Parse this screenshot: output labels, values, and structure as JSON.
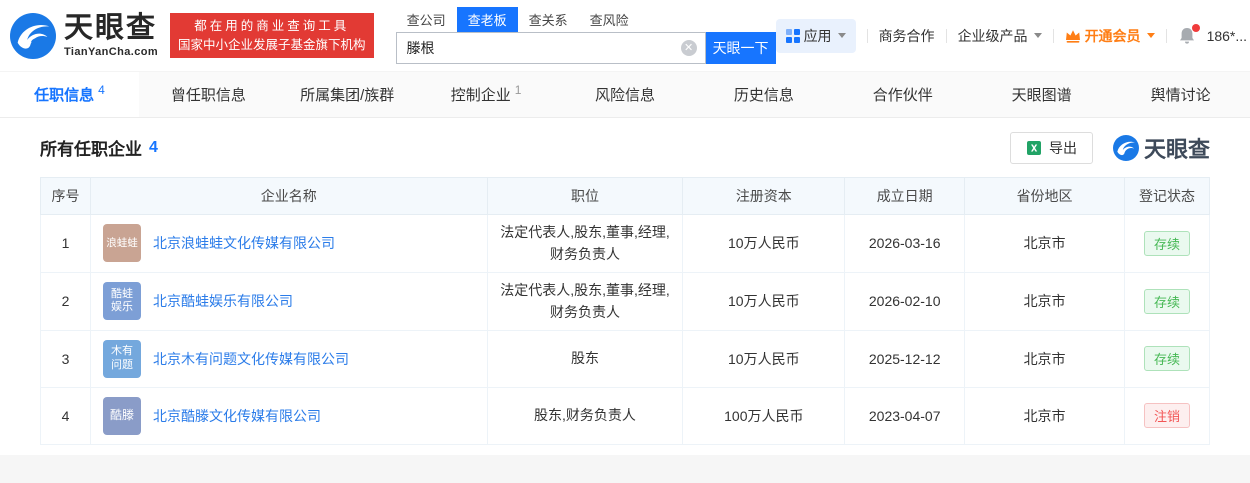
{
  "header": {
    "logo": {
      "title": "天眼查",
      "subtitle": "TianYanCha.com"
    },
    "slogan": {
      "line1": "都在用的商业查询工具",
      "line2": "国家中小企业发展子基金旗下机构"
    },
    "search": {
      "tabs": [
        {
          "label": "查公司",
          "active": false
        },
        {
          "label": "查老板",
          "active": true
        },
        {
          "label": "查关系",
          "active": false
        },
        {
          "label": "查风险",
          "active": false
        }
      ],
      "value": "滕根",
      "button_label": "天眼一下"
    },
    "nav": {
      "apps_label": "应用",
      "biz_label": "商务合作",
      "enterprise_label": "企业级产品",
      "vip_label": "开通会员",
      "phone_label": "186*..."
    }
  },
  "section_tabs": [
    {
      "label": "任职信息",
      "count": "4",
      "active": true
    },
    {
      "label": "曾任职信息"
    },
    {
      "label": "所属集团/族群"
    },
    {
      "label": "控制企业",
      "count": "1"
    },
    {
      "label": "风险信息"
    },
    {
      "label": "历史信息"
    },
    {
      "label": "合作伙伴"
    },
    {
      "label": "天眼图谱"
    },
    {
      "label": "舆情讨论"
    }
  ],
  "section": {
    "title": "所有任职企业",
    "count": "4",
    "export_label": "导出",
    "watermark": "天眼查"
  },
  "table": {
    "headers": [
      "序号",
      "企业名称",
      "职位",
      "注册资本",
      "成立日期",
      "省份地区",
      "登记状态"
    ],
    "rows": [
      {
        "no": "1",
        "avatar_lines": [
          "浪蛙蛙"
        ],
        "avatar_color": "#c9a493",
        "company": "北京浪蛙蛙文化传媒有限公司",
        "position": "法定代表人,股东,董事,经理,财务负责人",
        "capital": "10万人民币",
        "date": "2026-03-16",
        "province": "北京市",
        "status": "存续",
        "status_type": "active"
      },
      {
        "no": "2",
        "avatar_lines": [
          "酷蛙",
          "娱乐"
        ],
        "avatar_color": "#7d9fd6",
        "company": "北京酷蛙娱乐有限公司",
        "position": "法定代表人,股东,董事,经理,财务负责人",
        "capital": "10万人民币",
        "date": "2026-02-10",
        "province": "北京市",
        "status": "存续",
        "status_type": "active"
      },
      {
        "no": "3",
        "avatar_lines": [
          "木有",
          "问题"
        ],
        "avatar_color": "#74a8dd",
        "company": "北京木有问题文化传媒有限公司",
        "position": "股东",
        "capital": "10万人民币",
        "date": "2025-12-12",
        "province": "北京市",
        "status": "存续",
        "status_type": "active"
      },
      {
        "no": "4",
        "avatar_lines": [
          "酷滕"
        ],
        "avatar_color": "#8a9cc8",
        "company": "北京酷滕文化传媒有限公司",
        "position": "股东,财务负责人",
        "capital": "100万人民币",
        "date": "2023-04-07",
        "province": "北京市",
        "status": "注销",
        "status_type": "cancelled"
      }
    ]
  },
  "colors": {
    "brand_blue": "#1775ff",
    "link_blue": "#2b7ce9",
    "slogan_red": "#e23a34",
    "vip_orange": "#ff7e15",
    "status_active_green": "#46b854",
    "status_cancelled_red": "#f25555"
  }
}
